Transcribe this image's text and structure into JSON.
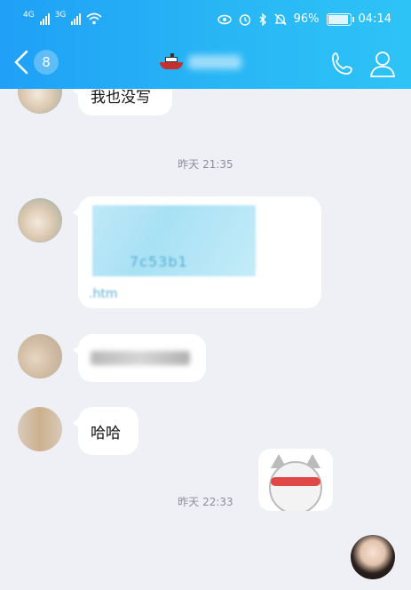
{
  "status_bar": {
    "network_1": "4G",
    "network_2": "3G",
    "battery_percent": "96%",
    "time": "04:14"
  },
  "nav": {
    "unread_count": "8"
  },
  "messages": [
    {
      "text": "我也没写"
    },
    {
      "text": "哈哈"
    }
  ],
  "timestamps": [
    "昨天 21:35",
    "昨天 22:33"
  ],
  "link_partial": "7c53b1",
  "link_partial_2": ".htm"
}
